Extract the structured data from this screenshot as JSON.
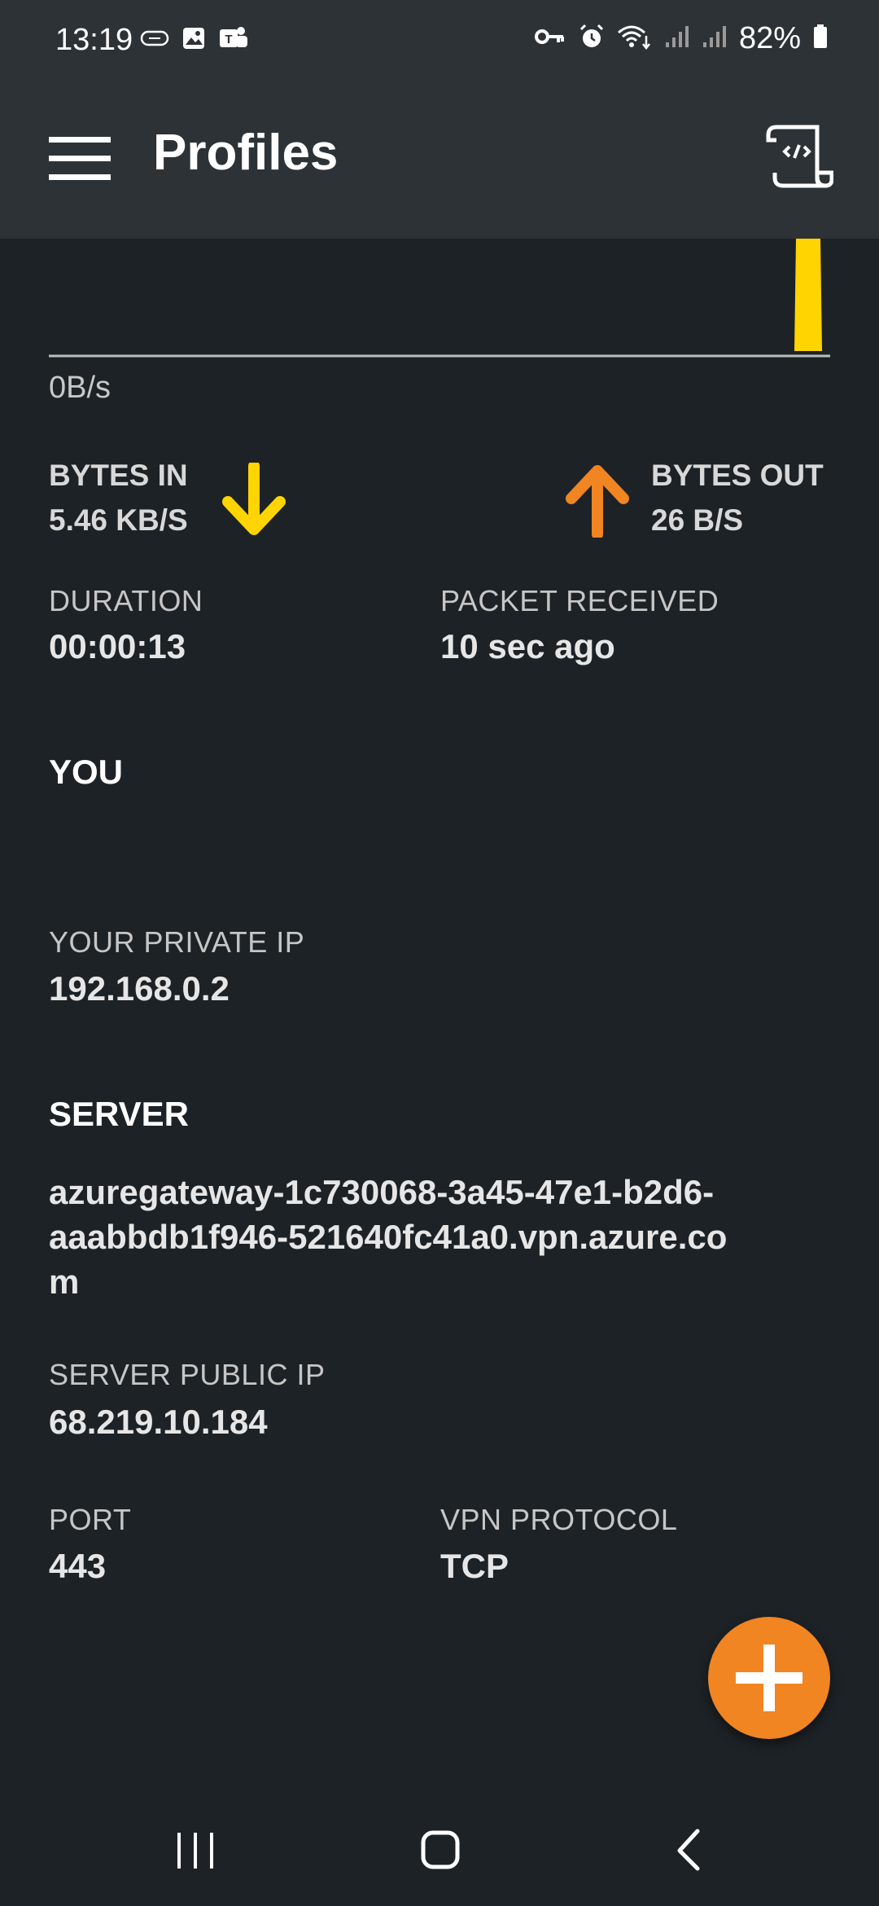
{
  "status_bar": {
    "time": "13:19",
    "battery": "82%",
    "left_icons": [
      "tag-icon",
      "gallery-icon",
      "teams-icon"
    ],
    "right_icons": [
      "vpn-key-icon",
      "alarm-icon",
      "wifi-icon",
      "signal-icon",
      "signal-icon",
      "battery-icon"
    ]
  },
  "app_bar": {
    "title": "Profiles",
    "menu_icon": "hamburger-menu-icon",
    "log_icon": "log-scroll-icon"
  },
  "graph": {
    "axis_label": "0B/s",
    "colors": {
      "bytes_in": "#ffd400",
      "baseline": "#bdbdbd"
    }
  },
  "traffic": {
    "bytes_in_label": "BYTES IN",
    "bytes_in_value": "5.46 KB/S",
    "bytes_out_label": "BYTES OUT",
    "bytes_out_value": "26 B/S",
    "colors": {
      "in_arrow": "#ffd400",
      "out_arrow": "#f08522"
    }
  },
  "stats": {
    "duration_label": "DURATION",
    "duration_value": "00:00:13",
    "packet_label": "PACKET RECEIVED",
    "packet_value": "10 sec ago"
  },
  "you": {
    "title": "YOU",
    "private_ip_label": "YOUR PRIVATE IP",
    "private_ip_value": "192.168.0.2"
  },
  "server": {
    "title": "SERVER",
    "hostname_line1": "azuregateway-1c730068-3a45-47e1-b2d6-",
    "hostname_line2": "aaabbdb1f946-521640fc41a0.vpn.azure.co",
    "hostname_line3": "m",
    "public_ip_label": "SERVER PUBLIC IP",
    "public_ip_value": "68.219.10.184",
    "port_label": "PORT",
    "port_value": "443",
    "protocol_label": "VPN PROTOCOL",
    "protocol_value": "TCP"
  },
  "fab": {
    "icon": "plus-icon",
    "color": "#f08522"
  },
  "nav": {
    "icons": [
      "recent-apps-icon",
      "home-icon",
      "back-icon"
    ]
  }
}
